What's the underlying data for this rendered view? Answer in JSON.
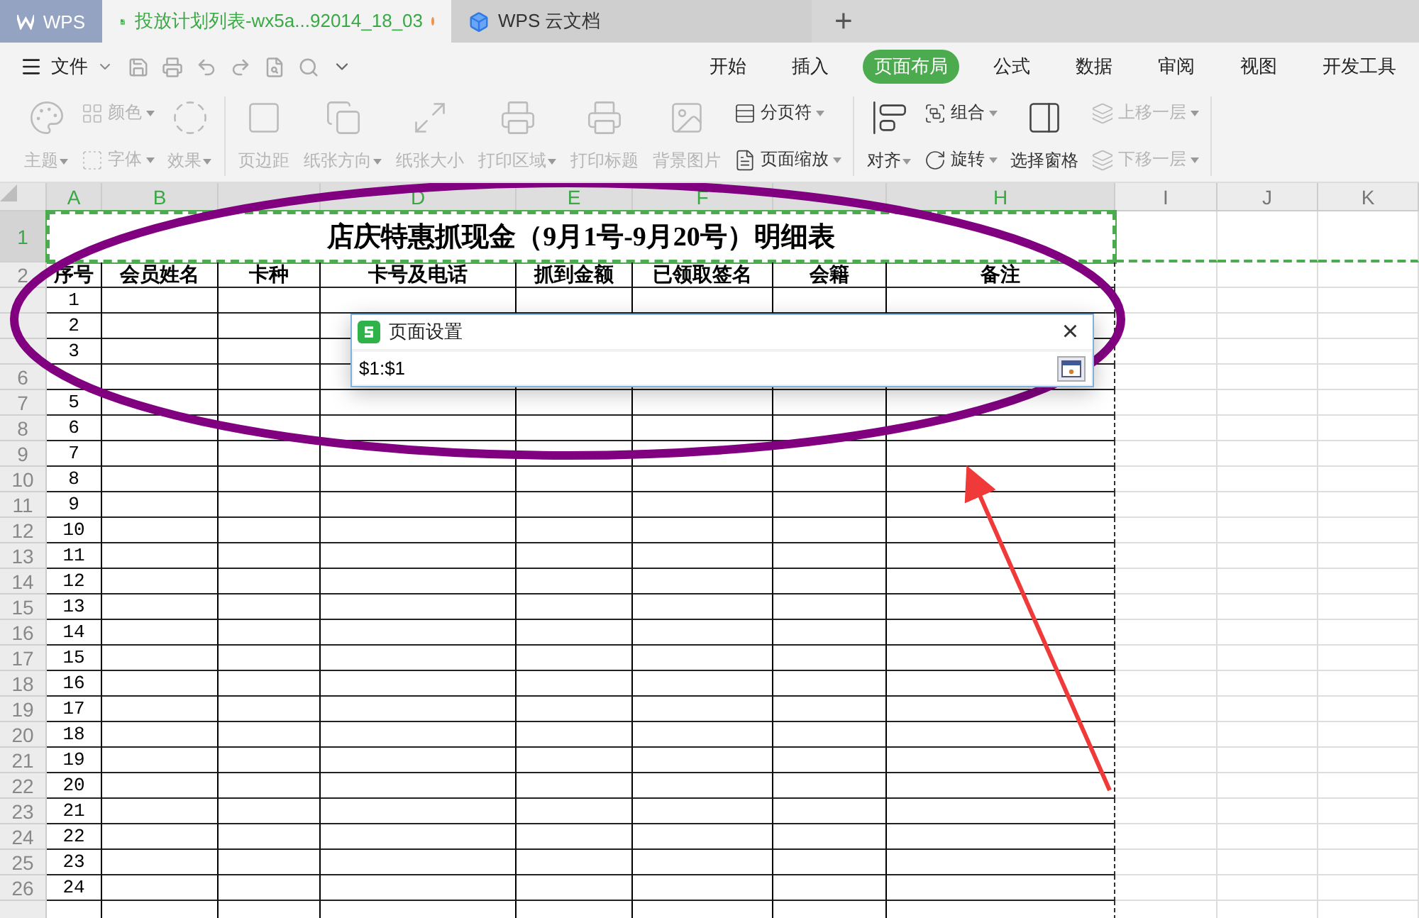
{
  "tabs": [
    {
      "kind": "home",
      "label": "WPS",
      "selected": false
    },
    {
      "kind": "document",
      "label": "投放计划列表-wx5a...92014_18_03",
      "selected": true,
      "unsaved": true
    },
    {
      "kind": "cloud",
      "label": "WPS 云文档",
      "selected": false
    }
  ],
  "new_tab": "+",
  "menu": {
    "file": "文件",
    "ribbon_tabs": [
      {
        "label": "开始",
        "selected": false
      },
      {
        "label": "插入",
        "selected": false
      },
      {
        "label": "页面布局",
        "selected": true
      },
      {
        "label": "公式",
        "selected": false
      },
      {
        "label": "数据",
        "selected": false
      },
      {
        "label": "审阅",
        "selected": false
      },
      {
        "label": "视图",
        "selected": false
      },
      {
        "label": "开发工具",
        "selected": false
      }
    ]
  },
  "ribbon": {
    "groups": [
      {
        "items": [
          {
            "kind": "large",
            "label": "主题",
            "disabled": true,
            "dropdown": true
          },
          {
            "kind": "stack",
            "items": [
              {
                "label": "颜色",
                "disabled": true,
                "dropdown": true
              },
              {
                "label": "字体",
                "disabled": true,
                "dropdown": true
              }
            ]
          },
          {
            "kind": "large",
            "label": "效果",
            "disabled": true,
            "dropdown": true
          }
        ]
      },
      {
        "items": [
          {
            "kind": "large",
            "label": "页边距",
            "disabled": true,
            "dropdown": false
          },
          {
            "kind": "large",
            "label": "纸张方向",
            "disabled": true,
            "dropdown": true
          },
          {
            "kind": "large",
            "label": "纸张大小",
            "disabled": true,
            "dropdown": false
          },
          {
            "kind": "large",
            "label": "打印区域",
            "disabled": true,
            "dropdown": true
          },
          {
            "kind": "large",
            "label": "打印标题",
            "disabled": true,
            "dropdown": false
          },
          {
            "kind": "large",
            "label": "背景图片",
            "disabled": true,
            "dropdown": false
          },
          {
            "kind": "stack",
            "items": [
              {
                "label": "分页符",
                "disabled": false,
                "dropdown": true
              },
              {
                "label": "页面缩放",
                "disabled": false,
                "dropdown": true
              }
            ]
          }
        ]
      },
      {
        "items": [
          {
            "kind": "large",
            "label": "对齐",
            "disabled": false,
            "dropdown": true
          },
          {
            "kind": "stack",
            "items": [
              {
                "label": "组合",
                "disabled": false,
                "dropdown": true
              },
              {
                "label": "旋转",
                "disabled": false,
                "dropdown": true
              }
            ]
          },
          {
            "kind": "large",
            "label": "选择窗格",
            "disabled": false,
            "dropdown": false
          },
          {
            "kind": "stack",
            "items": [
              {
                "label": "上移一层",
                "disabled": true,
                "dropdown": true
              },
              {
                "label": "下移一层",
                "disabled": true,
                "dropdown": true
              }
            ]
          }
        ]
      }
    ]
  },
  "sheet": {
    "columns": [
      {
        "label": "A",
        "selected": true
      },
      {
        "label": "B",
        "selected": true
      },
      {
        "selected": true
      },
      {
        "label": "D",
        "selected": true
      },
      {
        "label": "E",
        "selected": true
      },
      {
        "label": "F",
        "selected": true
      },
      {
        "selected": true
      },
      {
        "label": "H",
        "selected": true
      },
      {
        "label": "I",
        "selected": false
      },
      {
        "label": "J",
        "selected": false
      },
      {
        "label": "K",
        "selected": false
      }
    ],
    "title_row": {
      "header": "1",
      "selected": true,
      "title": "店庆特惠抓现金（9月1号-9月20号）明细表"
    },
    "rows": [
      {
        "header": "2",
        "kind": "header",
        "selected": false,
        "cells": [
          "序号",
          "会员姓名",
          "卡种",
          "卡号及电话",
          "抓到金额",
          "已领取签名",
          "会籍",
          "备注"
        ]
      },
      {
        "kind": "data",
        "selected": false,
        "cells": [
          "1"
        ]
      },
      {
        "kind": "data",
        "selected": false,
        "cells": [
          "2"
        ]
      },
      {
        "kind": "data",
        "selected": false,
        "cells": [
          "3"
        ]
      },
      {
        "header": "6",
        "kind": "data",
        "selected": false,
        "cells": []
      },
      {
        "header": "7",
        "kind": "data",
        "selected": false,
        "cells": [
          "5"
        ]
      },
      {
        "header": "8",
        "kind": "data",
        "selected": false,
        "cells": [
          "6"
        ]
      },
      {
        "header": "9",
        "kind": "data",
        "selected": false,
        "cells": [
          "7"
        ]
      },
      {
        "header": "10",
        "kind": "data",
        "selected": false,
        "cells": [
          "8"
        ]
      },
      {
        "header": "11",
        "kind": "data",
        "selected": false,
        "cells": [
          "9"
        ]
      },
      {
        "header": "12",
        "kind": "data",
        "selected": false,
        "cells": [
          "10"
        ]
      },
      {
        "header": "13",
        "kind": "data",
        "selected": false,
        "cells": [
          "11"
        ]
      },
      {
        "header": "14",
        "kind": "data",
        "selected": false,
        "cells": [
          "12"
        ]
      },
      {
        "header": "15",
        "kind": "data",
        "selected": false,
        "cells": [
          "13"
        ]
      },
      {
        "header": "16",
        "kind": "data",
        "selected": false,
        "cells": [
          "14"
        ]
      },
      {
        "header": "17",
        "kind": "data",
        "selected": false,
        "cells": [
          "15"
        ]
      },
      {
        "header": "18",
        "kind": "data",
        "selected": false,
        "cells": [
          "16"
        ]
      },
      {
        "header": "19",
        "kind": "data",
        "selected": false,
        "cells": [
          "17"
        ]
      },
      {
        "header": "20",
        "kind": "data",
        "selected": false,
        "cells": [
          "18"
        ]
      },
      {
        "header": "21",
        "kind": "data",
        "selected": false,
        "cells": [
          "19"
        ]
      },
      {
        "header": "22",
        "kind": "data",
        "selected": false,
        "cells": [
          "20"
        ]
      },
      {
        "header": "23",
        "kind": "data",
        "selected": false,
        "cells": [
          "21"
        ]
      },
      {
        "header": "24",
        "kind": "data",
        "selected": false,
        "cells": [
          "22"
        ]
      },
      {
        "header": "25",
        "kind": "data",
        "selected": false,
        "cells": [
          "23"
        ]
      },
      {
        "header": "26",
        "kind": "data",
        "selected": false,
        "cells": [
          "24"
        ]
      }
    ]
  },
  "dialog": {
    "title": "页面设置",
    "close": "×",
    "value": "$1:$1"
  }
}
